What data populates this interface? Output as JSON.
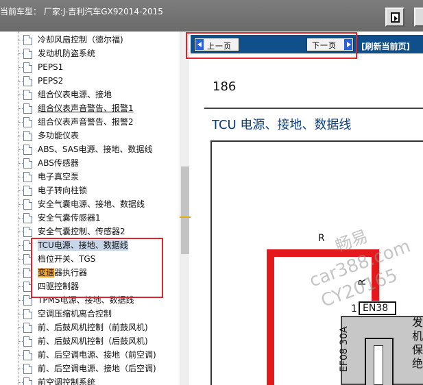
{
  "header": {
    "title": "当前车型：  厂家:J-吉利汽车GX92014-2015"
  },
  "tree": {
    "items": [
      {
        "label": "冷却风扇控制（德尔福)"
      },
      {
        "label": "发动机防盗系统"
      },
      {
        "label": "PEPS1"
      },
      {
        "label": "PEPS2"
      },
      {
        "label": "组合仪表电源、接地"
      },
      {
        "label": "组合仪表声音警告、报警1"
      },
      {
        "label": "组合仪表声音警告、报警2"
      },
      {
        "label": "多功能仪表"
      },
      {
        "label": "ABS、SAS电源、接地、数据线"
      },
      {
        "label": "ABS传感器"
      },
      {
        "label": "电子真空泵"
      },
      {
        "label": "电子转向柱锁"
      },
      {
        "label": "安全气囊电源、接地、数据线"
      },
      {
        "label": "安全气囊传感器1"
      },
      {
        "label": "安全气囊控制、传感器2"
      },
      {
        "label": "TCU电源、接地、数据线"
      },
      {
        "label": "档位开关、TGS"
      },
      {
        "label_highlight": "变速",
        "label_rest": "器执行器"
      },
      {
        "label": "四驱控制器"
      },
      {
        "label": "TPMS电源、接地、数据线"
      },
      {
        "label": "空调压缩机离合控制"
      },
      {
        "label": "前、后鼓风机控制（前鼓风机)"
      },
      {
        "label": "前、后鼓风机控制（后鼓风机)"
      },
      {
        "label": "前、后空调电源、接地（前空调)"
      },
      {
        "label": "前、后空调电源、接地（后空调)"
      },
      {
        "label": "前空调控制系统"
      }
    ]
  },
  "nav": {
    "prev_label": "上一页",
    "next_label": "下一页",
    "refresh_label": "[刷新当前页]"
  },
  "document": {
    "page_number": "186",
    "title": "TCU 电源、接地、数据线",
    "diagram": {
      "wire_color_top": "R",
      "wire_color_side": "R",
      "pin": "1",
      "connector": "EN38",
      "fuse": "EF08 30A",
      "side_text": "发机保绝"
    },
    "watermark": {
      "line1": "畅易",
      "line2": "car388.com",
      "line3": "CY20165"
    }
  },
  "colors": {
    "annotation": "#e0242b",
    "nav_bar": "#0e4f8c",
    "wire": "#e3191b",
    "title_text": "#0b3c7d",
    "highlight": "#f7a52d"
  }
}
